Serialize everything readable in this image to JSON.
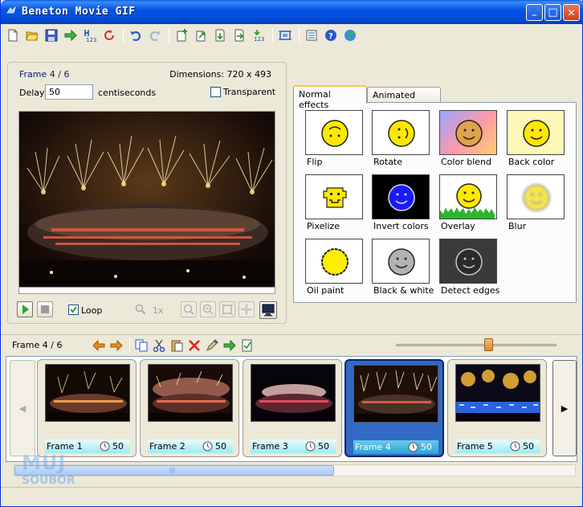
{
  "window": {
    "title": "Beneton Movie GIF",
    "minimize": "_",
    "maximize": "□",
    "close": "✕"
  },
  "toolbar_icons": [
    "new-file-icon",
    "open-folder-icon",
    "save-icon",
    "export-icon",
    "renumber-icon",
    "refresh-icon",
    "undo-icon",
    "redo-icon",
    "add-frame-icon",
    "import-frame-icon",
    "insert-frame-icon",
    "append-frame-icon",
    "numbered-frames-icon",
    "crop-icon",
    "properties-icon",
    "help-icon",
    "web-icon"
  ],
  "preview": {
    "frame_label": "Frame 4 / 6",
    "dimensions": "Dimensions: 720 x 493",
    "delay_label": "Delay",
    "delay_value": "50",
    "delay_unit": "centiseconds",
    "transparent_label": "Transparent",
    "transparent_checked": false,
    "loop_label": "Loop",
    "loop_checked": true,
    "zoom_label": "1x"
  },
  "effects": {
    "tabs": [
      {
        "label": "Normal effects",
        "active": true
      },
      {
        "label": "Animated effects",
        "active": false
      }
    ],
    "items": [
      {
        "label": "Flip"
      },
      {
        "label": "Rotate"
      },
      {
        "label": "Color blend"
      },
      {
        "label": "Back color"
      },
      {
        "label": "Pixelize"
      },
      {
        "label": "Invert colors"
      },
      {
        "label": "Overlay"
      },
      {
        "label": "Blur"
      },
      {
        "label": "Oil paint"
      },
      {
        "label": "Black & white"
      },
      {
        "label": "Detect edges"
      }
    ]
  },
  "frames": {
    "label": "Frame 4 / 6",
    "zoom_level": 0.58,
    "items": [
      {
        "name": "Frame 1",
        "delay": "50",
        "selected": false
      },
      {
        "name": "Frame 2",
        "delay": "50",
        "selected": false
      },
      {
        "name": "Frame 3",
        "delay": "50",
        "selected": false
      },
      {
        "name": "Frame 4",
        "delay": "50",
        "selected": true
      },
      {
        "name": "Frame 5",
        "delay": "50",
        "selected": false
      }
    ],
    "nav_left": "◀",
    "nav_right": "▶",
    "scroll_grip": "|||"
  },
  "watermark": {
    "line1": "MUJ",
    "line2": "SOUBOR"
  },
  "colors": {
    "titlebar": "#0554e3",
    "selection": "#316ac5",
    "frame_bar": "#9ee9f2",
    "tab_highlight": "#ffc83c"
  }
}
